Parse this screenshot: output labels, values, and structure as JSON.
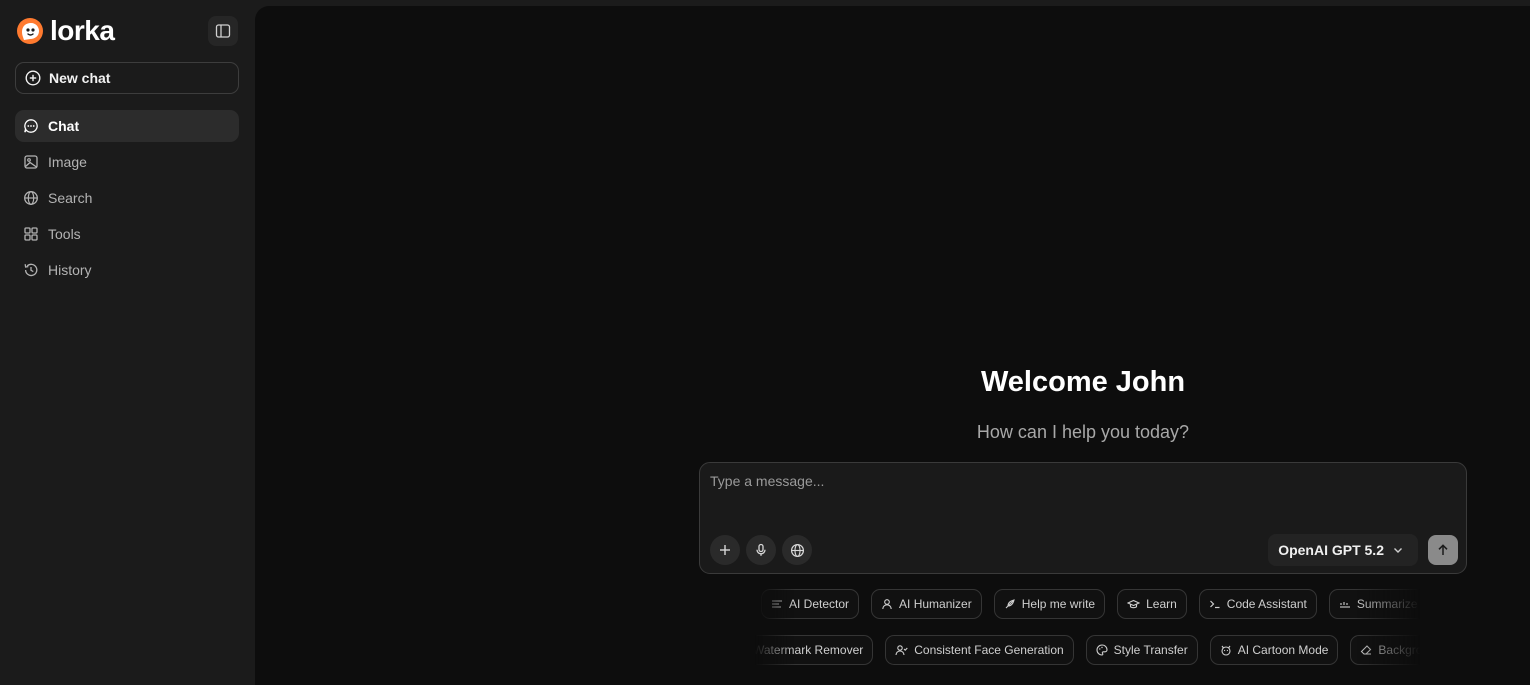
{
  "brand": {
    "name": "lorka"
  },
  "sidebar": {
    "new_chat_label": "New chat",
    "items": [
      {
        "label": "Chat",
        "icon": "chat-bubble-icon",
        "active": true
      },
      {
        "label": "Image",
        "icon": "image-icon",
        "active": false
      },
      {
        "label": "Search",
        "icon": "globe-icon",
        "active": false
      },
      {
        "label": "Tools",
        "icon": "grid-icon",
        "active": false
      },
      {
        "label": "History",
        "icon": "history-icon",
        "active": false
      }
    ]
  },
  "main": {
    "welcome": "Welcome John",
    "subtitle": "How can I help you today?"
  },
  "composer": {
    "placeholder": "Type a message...",
    "model": "OpenAI GPT 5.2"
  },
  "suggestions": {
    "row1": [
      "AI Detector",
      "AI Humanizer",
      "Help me write",
      "Learn",
      "Code Assistant",
      "Summarize"
    ],
    "row2": [
      "Watermark Remover",
      "Consistent Face Generation",
      "Style Transfer",
      "AI Cartoon Mode",
      "Background"
    ]
  },
  "colors": {
    "logo_orange": "#ff7a2f",
    "sidebar_bg": "#1b1b1b",
    "main_bg": "#0d0d0d"
  }
}
